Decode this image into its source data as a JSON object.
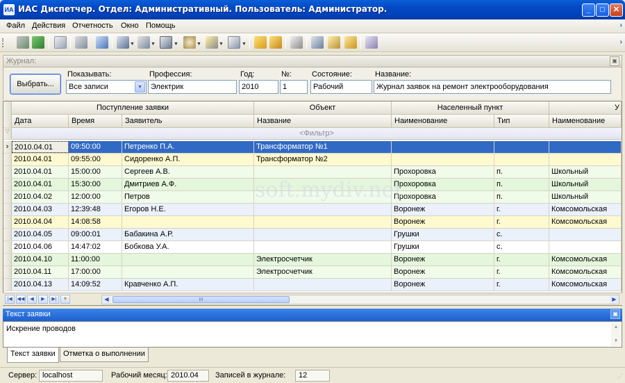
{
  "window": {
    "title": "ИАС Диспетчер. Отдел: Административный. Пользователь: Администратор.",
    "app_icon": "ias-app-icon",
    "controls": {
      "minimize": "_",
      "maximize": "□",
      "close": "✕"
    }
  },
  "menu": {
    "items": [
      "Файл",
      "Действия",
      "Отчетность",
      "Окно",
      "Помощь"
    ]
  },
  "journal": {
    "panel_title": "Журнал:",
    "select_button": "Выбрать...",
    "show_label": "Показывать:",
    "show_value": "Все записи",
    "profession_label": "Профессия:",
    "profession_value": "Электрик",
    "year_label": "Год:",
    "year_value": "2010",
    "number_label": "№:",
    "number_value": "1",
    "state_label": "Состояние:",
    "state_value": "Рабочий",
    "name_label": "Название:",
    "name_value": "Журнал заявок на ремонт электрооборудования"
  },
  "grid": {
    "group_headers": [
      "Поступление заявки",
      "Объект",
      "Населенный пункт",
      "У"
    ],
    "columns": [
      "Дата",
      "Время",
      "Заявитель",
      "Название",
      "Наименование",
      "Тип",
      "Наименование"
    ],
    "filter_placeholder": "<Фильтр>",
    "rows": [
      {
        "date": "2010.04.01",
        "time": "09:50:00",
        "applicant": "Петренко П.А.",
        "object": "Трансформатор №1",
        "locality": "",
        "type": "",
        "street": "",
        "style": "selected"
      },
      {
        "date": "2010.04.01",
        "time": "09:55:00",
        "applicant": "Сидоренко А.П.",
        "object": "Трансформатор №2",
        "locality": "",
        "type": "",
        "street": "",
        "style": "yellow"
      },
      {
        "date": "2010.04.01",
        "time": "15:00:00",
        "applicant": "Сергеев А.В.",
        "object": "",
        "locality": "Прохоровка",
        "type": "п.",
        "street": "Школьный",
        "style": "lightgreen"
      },
      {
        "date": "2010.04.01",
        "time": "15:30:00",
        "applicant": "Дмитриев А.Ф.",
        "object": "",
        "locality": "Прохоровка",
        "type": "п.",
        "street": "Школьный",
        "style": "green"
      },
      {
        "date": "2010.04.02",
        "time": "12:00:00",
        "applicant": "Петров",
        "object": "",
        "locality": "Прохоровка",
        "type": "п.",
        "street": "Школьный",
        "style": "lightgreen"
      },
      {
        "date": "2010.04.03",
        "time": "12:39:48",
        "applicant": "Егоров Н.Е.",
        "object": "",
        "locality": "Воронеж",
        "type": "г.",
        "street": "Комсомольская",
        "style": "blue"
      },
      {
        "date": "2010.04.04",
        "time": "14:08:58",
        "applicant": "",
        "object": "",
        "locality": "Воронеж",
        "type": "г.",
        "street": "Комсомольская",
        "style": "yellow"
      },
      {
        "date": "2010.04.05",
        "time": "09:00:01",
        "applicant": "Бабакина А.Р.",
        "object": "",
        "locality": "Грушки",
        "type": "с.",
        "street": "",
        "style": "blue"
      },
      {
        "date": "2010.04.06",
        "time": "14:47:02",
        "applicant": "Бобкова У.А.",
        "object": "",
        "locality": "Грушки",
        "type": "с.",
        "street": "",
        "style": "white"
      },
      {
        "date": "2010.04.10",
        "time": "11:00:00",
        "applicant": "",
        "object": "Электросчетчик",
        "locality": "Воронеж",
        "type": "г.",
        "street": "Комсомольская",
        "style": "green"
      },
      {
        "date": "2010.04.11",
        "time": "17:00:00",
        "applicant": "",
        "object": "Электросчетчик",
        "locality": "Воронеж",
        "type": "г.",
        "street": "Комсомольская",
        "style": "lightgreen"
      },
      {
        "date": "2010.04.13",
        "time": "14:09:52",
        "applicant": "Кравченко А.П.",
        "object": "",
        "locality": "Воронеж",
        "type": "г.",
        "street": "Комсомольская",
        "style": "blue"
      }
    ],
    "scroll_thumb_glyph": "III"
  },
  "note": {
    "panel_title": "Текст заявки",
    "text": "Искрение проводов",
    "tabs": [
      "Текст заявки",
      "Отметка о выполнении"
    ]
  },
  "status": {
    "server_label": "Сервер:",
    "server_value": "localhost",
    "month_label": "Рабочий месяц:",
    "month_value": "2010.04",
    "records_label": "Записей в журнале:",
    "records_value": "12"
  },
  "watermark": "soft.mydiv.net",
  "colors": {
    "selected": "#316ac5",
    "yellow": "#fff9d0",
    "green": "#e4f6dc",
    "lightgreen": "#f0fbe9",
    "blue": "#eaf1fb",
    "white": "#ffffff"
  }
}
